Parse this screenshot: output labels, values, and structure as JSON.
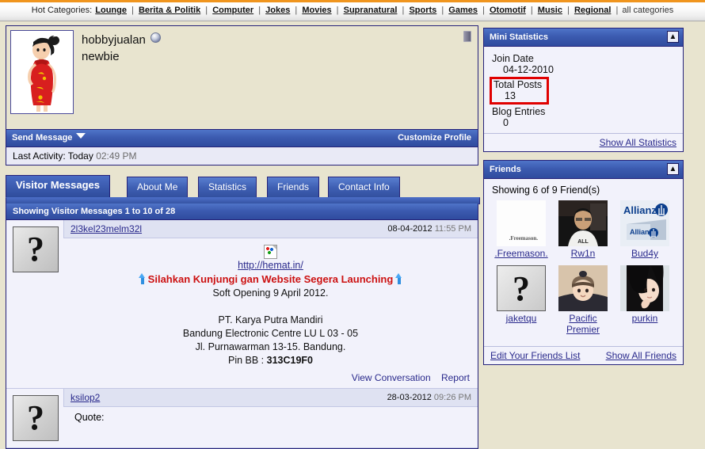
{
  "topbar": {
    "label": "Hot Categories:",
    "categories": [
      "Lounge",
      "Berita & Politik",
      "Computer",
      "Jokes",
      "Movies",
      "Supranatural",
      "Sports",
      "Games",
      "Otomotif",
      "Music",
      "Regional"
    ],
    "all_categories": "all categories",
    "separator": "|"
  },
  "profile": {
    "username": "hobbyjualan",
    "usertitle": "newbie",
    "avatar_icon": "anime-girl-red-dress-avatar",
    "online_icon": "online-status-ball",
    "corner_icon": "profile-corner-icon",
    "send_message": "Send Message",
    "customize_profile": "Customize Profile",
    "last_activity_label": "Last Activity: Today",
    "last_activity_time": "02:49 PM"
  },
  "tabs": [
    {
      "label": "Visitor Messages",
      "active": true
    },
    {
      "label": "About Me",
      "active": false
    },
    {
      "label": "Statistics",
      "active": false
    },
    {
      "label": "Friends",
      "active": false
    },
    {
      "label": "Contact Info",
      "active": false
    }
  ],
  "visitor_messages": {
    "header": "Showing Visitor Messages 1 to 10 of 28",
    "messages": [
      {
        "author": "2l3kel23melm32l",
        "date": "08-04-2012",
        "time": "11:55 PM",
        "avatar_icon": "question-mark-avatar",
        "broken_image_icon": "broken-image-icon",
        "link": "http://hemat.in/",
        "headline": "Silahkan Kunjungi gan Website Segera Launching",
        "arrow_icon": "blue-up-arrow-icon",
        "lines": [
          "Soft Opening 9 April 2012.",
          "",
          "PT. Karya Putra Mandiri",
          "Bandung Electronic Centre LU L 03 - 05",
          "Jl. Purnawarman 13-15. Bandung."
        ],
        "pin_label": "Pin BB : ",
        "pin_value": "313C19F0",
        "actions": [
          "View Conversation",
          "Report"
        ]
      },
      {
        "author": "ksilop2",
        "date": "28-03-2012",
        "time": "09:26 PM",
        "avatar_icon": "question-mark-avatar",
        "quote_label": "Quote:"
      }
    ]
  },
  "mini_statistics": {
    "title": "Mini Statistics",
    "collapse_icon": "collapse-icon",
    "rows": [
      {
        "label": "Join Date",
        "value": "04-12-2010",
        "highlight": false
      },
      {
        "label": "Total Posts",
        "value": "13",
        "highlight": true
      },
      {
        "label": "Blog Entries",
        "value": "0",
        "highlight": false
      }
    ],
    "footer_link": "Show All Statistics",
    "highlight_color": "#e00000"
  },
  "friends": {
    "title": "Friends",
    "collapse_icon": "collapse-icon",
    "count_text": "Showing 6 of 9 Friend(s)",
    "list": [
      {
        "name": ".Freemason.",
        "thumb": "freemason-logo-thumb"
      },
      {
        "name": "Rw1n",
        "thumb": "man-photo-thumb"
      },
      {
        "name": "Bud4y",
        "thumb": "allianz-logo-thumb"
      },
      {
        "name": "jaketqu",
        "thumb": "question-mark-avatar"
      },
      {
        "name": "Pacific Premier",
        "thumb": "baby-photo-thumb"
      },
      {
        "name": "purkin",
        "thumb": "girl-photo-thumb"
      }
    ],
    "edit_link": "Edit Your Friends List",
    "show_all_link": "Show All Friends"
  }
}
